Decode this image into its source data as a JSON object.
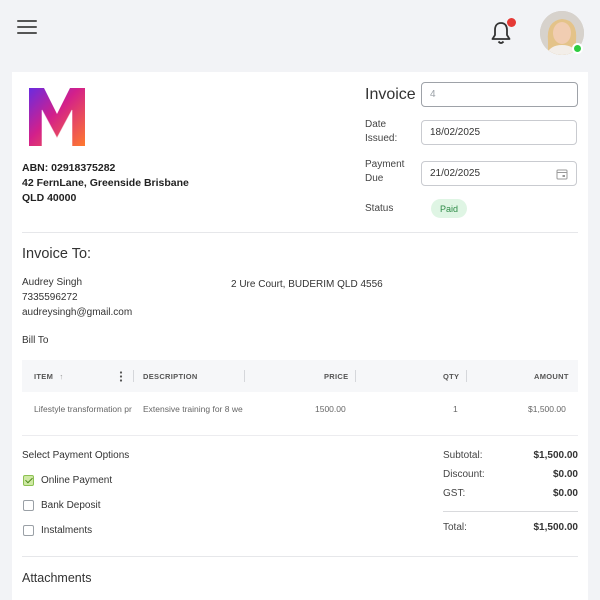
{
  "company": {
    "abn": "ABN: 02918375282",
    "address_line1": "42 FernLane, Greenside Brisbane",
    "address_line2": "QLD 40000"
  },
  "invoice": {
    "title": "Invoice",
    "number": "4",
    "date_issued_label_1": "Date",
    "date_issued_label_2": "Issued:",
    "date_issued": "18/02/2025",
    "payment_due_label_1": "Payment",
    "payment_due_label_2": "Due",
    "payment_due": "21/02/2025",
    "status_label": "Status",
    "status": "Paid"
  },
  "client": {
    "section_title": "Invoice To:",
    "name": "Audrey Singh",
    "phone": "7335596272",
    "email": "audreysingh@gmail.com",
    "address": "2 Ure Court, BUDERIM QLD 4556",
    "bill_to_label": "Bill To"
  },
  "table": {
    "headers": {
      "item": "ITEM",
      "description": "DESCRIPTION",
      "price": "PRICE",
      "qty": "QTY",
      "amount": "AMOUNT"
    },
    "rows": [
      {
        "item": "Lifestyle transformation pr",
        "description": "Extensive training for 8 we",
        "price": "1500.00",
        "qty": "1",
        "amount": "$1,500.00"
      }
    ]
  },
  "payment": {
    "title": "Select Payment Options",
    "options": [
      {
        "label": "Online Payment",
        "checked": true
      },
      {
        "label": "Bank Deposit",
        "checked": false
      },
      {
        "label": "Instalments",
        "checked": false
      }
    ]
  },
  "summary": {
    "subtotal_label": "Subtotal:",
    "subtotal": "$1,500.00",
    "discount_label": "Discount:",
    "discount": "$0.00",
    "gst_label": "GST:",
    "gst": "$0.00",
    "total_label": "Total:",
    "total": "$1,500.00"
  },
  "attachments": {
    "title": "Attachments"
  },
  "icons": {
    "menu": "menu-icon",
    "bell": "bell-icon",
    "avatar": "avatar",
    "calendar": "calendar-icon",
    "sort": "sort-arrow-icon",
    "more": "more-vertical-icon"
  },
  "colors": {
    "status_bg": "#dff5e4",
    "status_text": "#2e8b47",
    "notification_dot": "#e53935",
    "online": "#2ecc40"
  }
}
